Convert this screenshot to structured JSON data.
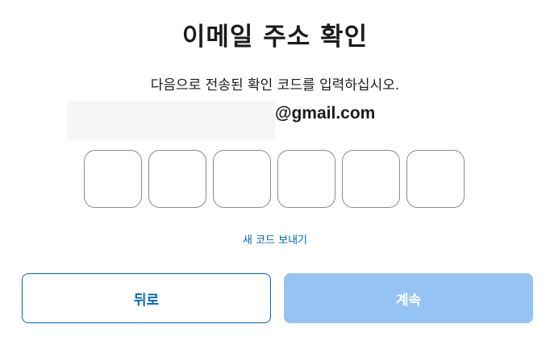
{
  "title": "이메일 주소 확인",
  "subtitle": "다음으로 전송된 확인 코드를 입력하십시오.",
  "email": {
    "domain": "@gmail.com"
  },
  "code": {
    "digits": [
      "",
      "",
      "",
      "",
      "",
      ""
    ]
  },
  "resend_label": "새 코드 보내기",
  "buttons": {
    "back_label": "뒤로",
    "continue_label": "계속"
  },
  "colors": {
    "accent": "#0067b8",
    "continue_disabled_bg": "#95c3f4",
    "code_box_border": "#8a8a8a"
  }
}
